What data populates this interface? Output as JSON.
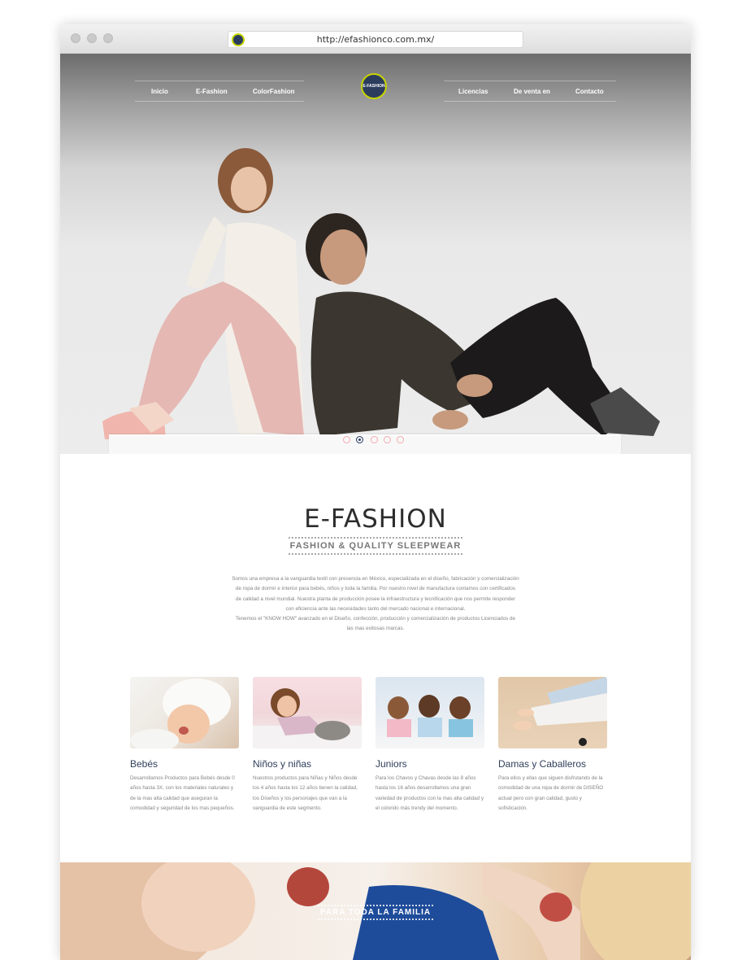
{
  "browser": {
    "url": "http://efashionco.com.mx/"
  },
  "nav": {
    "left": [
      "Inicio",
      "E-Fashion",
      "ColorFashion"
    ],
    "right": [
      "Licencias",
      "De venta en",
      "Contacto"
    ],
    "logo_text": "E-FASHION"
  },
  "hero": {
    "slides": 5,
    "active_slide": 2
  },
  "brand": {
    "title": "E-FASHION",
    "subtitle": "FASHION & QUALITY SLEEPWEAR",
    "intro": [
      "Somos una empresa a la vanguardia textil con presencia en México, especializada en el diseño, fabricación y comercialización",
      "de ropa de dormir e interior para bebés, niños y toda la familia. Por nuestro nivel de manufactura contamos con certificados",
      "de calidad a nivel mundial. Nuestra planta de producción posee la infraestructura y tecnificación que nos permite responder",
      "con eficiencia ante las necesidades tanto del mercado nacional e internacional.",
      "Tenemos el \"KNOW HOW\" avanzado en el Diseño, confección, producción y comercialización de productos Licenciados de",
      "las mas exitosas marcas."
    ]
  },
  "categories": [
    {
      "title": "Bebés",
      "text": "Desarrollamos Productos para Bebés desde 0 años hasta 3X, con los materiales naturales y de la mas alta calidad que aseguran la comodidad y seguridad de los mas pequeños."
    },
    {
      "title": "Niños y niñas",
      "text": "Nuestros productos para Niñas y Niños desde los 4 años hasta los 12 años tienen la calidad, los Diseños y los personajes que van a la vanguardia de este segmento."
    },
    {
      "title": "Juniors",
      "text": "Para los Chavos y Chavas desde las 8 años hasta los 16 años desarrollamos una gran variedad de productos con la mas alta calidad y el colorido más trendy del momento."
    },
    {
      "title": "Damas y Caballeros",
      "text": "Para ellos y ellas que siguen disfrutando de la comodidad de una ropa de dormir de DISEÑO actual pero con gran calidad, gusto y sofisticación."
    }
  ],
  "band": {
    "label": "PARA TODA LA FAMILIA"
  }
}
